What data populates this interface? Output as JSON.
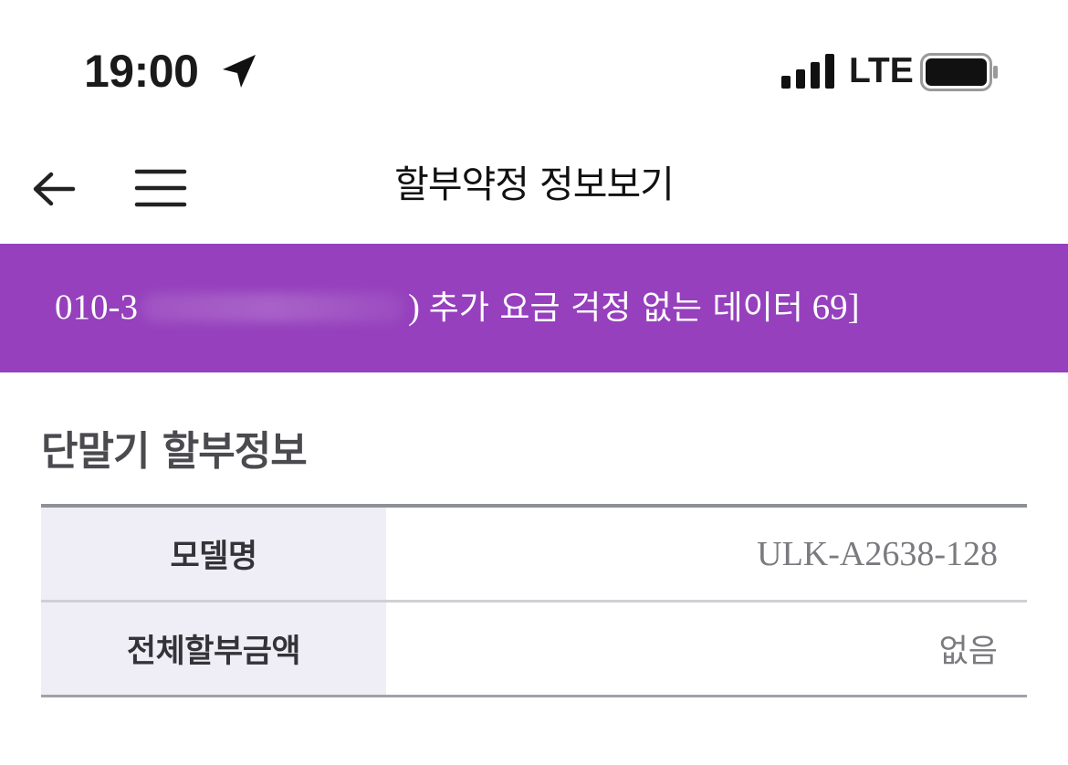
{
  "status_bar": {
    "time": "19:00",
    "network": "LTE",
    "icons": {
      "location": "location-arrow-icon",
      "signal": "signal-bars-icon",
      "battery": "battery-full-icon"
    }
  },
  "header": {
    "title": "할부약정 정보보기",
    "icons": {
      "back": "arrow-left-icon",
      "menu": "hamburger-menu-icon"
    }
  },
  "line_banner": {
    "number_prefix": "010-3",
    "number_suffix": ")",
    "plan": "추가 요금 걱정 없는 데이터",
    "plan_suffix": "69]",
    "background_color": "#9640bd"
  },
  "section": {
    "title": "단말기 할부정보",
    "rows": [
      {
        "label": "모델명",
        "value": "ULK-A2638-128"
      },
      {
        "label": "전체할부금액",
        "value": "없음"
      }
    ]
  }
}
